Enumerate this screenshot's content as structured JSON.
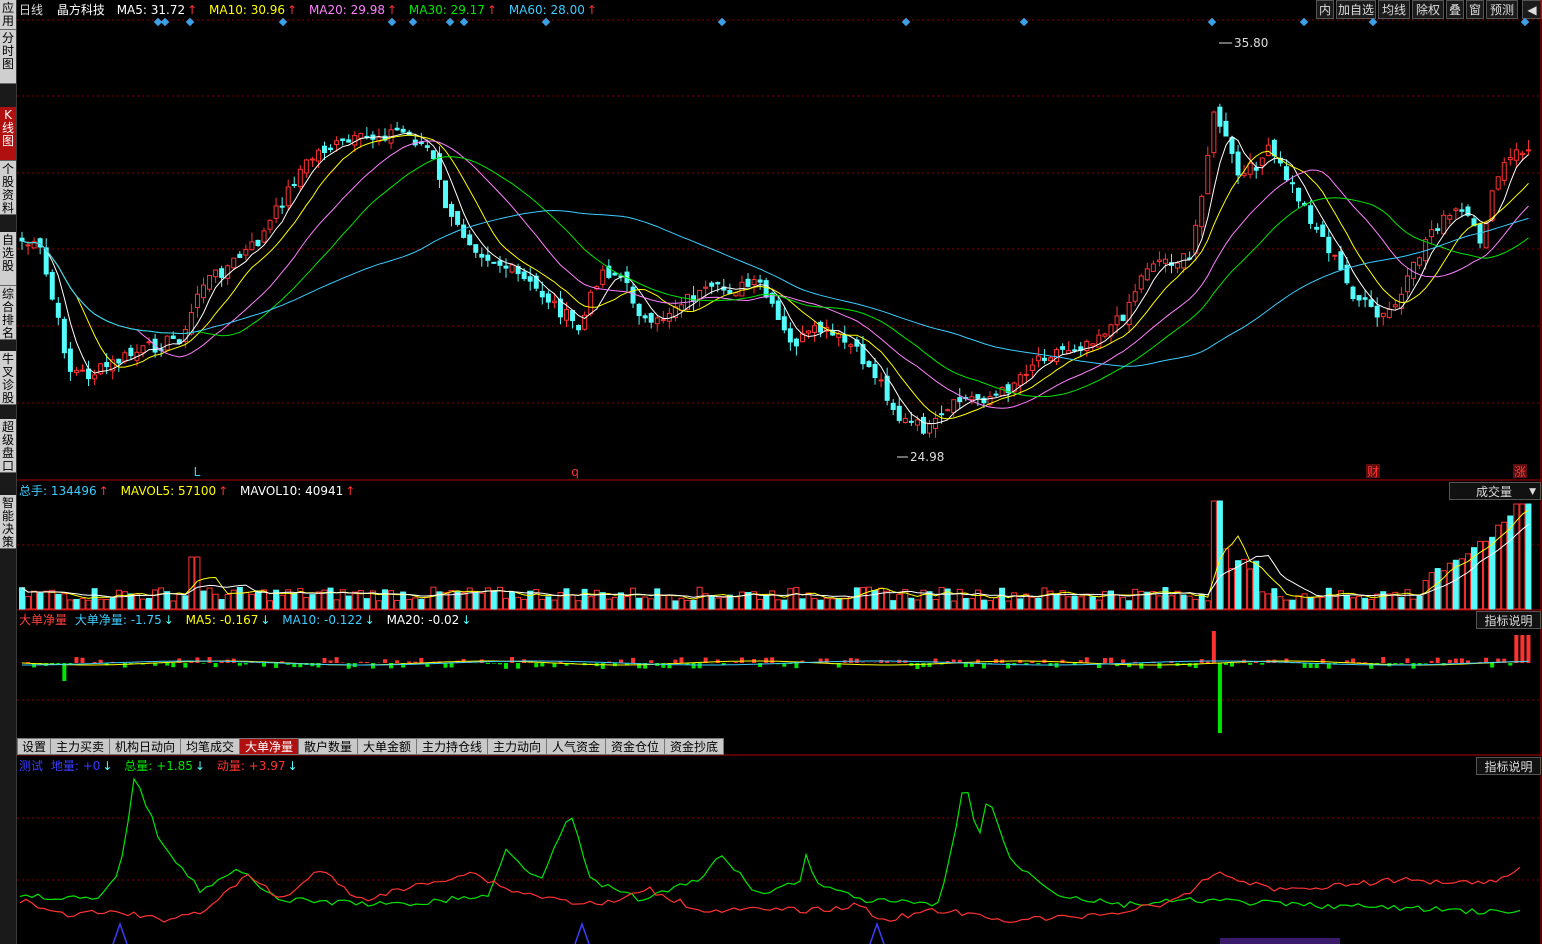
{
  "colors": {
    "up": "#ff3232",
    "down": "#54fcfc",
    "ma5": "#ffffff",
    "ma10": "#ffff00",
    "ma20": "#ff80ff",
    "ma30": "#00e600",
    "ma60": "#3ccdff",
    "grid": "#8b0000"
  },
  "sidebar": {
    "items": [
      {
        "label": "应用"
      },
      {
        "label": "分时图"
      },
      {
        "label": "K线图",
        "active": true
      },
      {
        "label": "个股资料"
      },
      {
        "label": "自选股"
      },
      {
        "label": "综合排名"
      },
      {
        "label": "牛叉诊股"
      },
      {
        "label": "超级盘口"
      },
      {
        "label": "智能决策"
      }
    ]
  },
  "toolbar": {
    "buttons": [
      "内",
      "加自选",
      "均线",
      "除权",
      "叠",
      "窗",
      "预测"
    ],
    "collapse_icon": "play-left-icon"
  },
  "kline": {
    "period": "日线",
    "stock_name": "晶方科技",
    "ma": [
      {
        "label": "MA5: 31.72",
        "arrow": "↑"
      },
      {
        "label": "MA10: 30.96",
        "arrow": "↑"
      },
      {
        "label": "MA20: 29.98",
        "arrow": "↑"
      },
      {
        "label": "MA30: 29.17",
        "arrow": "↑"
      },
      {
        "label": "MA60: 28.00",
        "arrow": "↑"
      }
    ],
    "high_label": "35.80",
    "low_label": "24.98",
    "markers": [
      "L",
      "q",
      "财",
      "涨"
    ]
  },
  "volume": {
    "total": "总手: 134496",
    "mavol5": "MAVOL5: 57100",
    "mavol10": "MAVOL10: 40941",
    "select": "成交量"
  },
  "bigorder": {
    "title": "大单净量",
    "value": "大单净量: -1.75",
    "ma5": "MA5: -0.167",
    "ma10": "MA10: -0.122",
    "ma20": "MA20: -0.02",
    "help": "指标说明"
  },
  "tabs": [
    "设置",
    "主力买卖",
    "机构日动向",
    "均笔成交",
    "大单净量",
    "散户数量",
    "大单金额",
    "主力持仓线",
    "主力动向",
    "人气资金",
    "资金仓位",
    "资金抄底"
  ],
  "active_tab": "大单净量",
  "bottom": {
    "name": "测试",
    "diliang": "地量: +0",
    "zongliang": "总量: +1.85",
    "dongliang": "动量: +3.97",
    "help": "指标说明"
  }
}
